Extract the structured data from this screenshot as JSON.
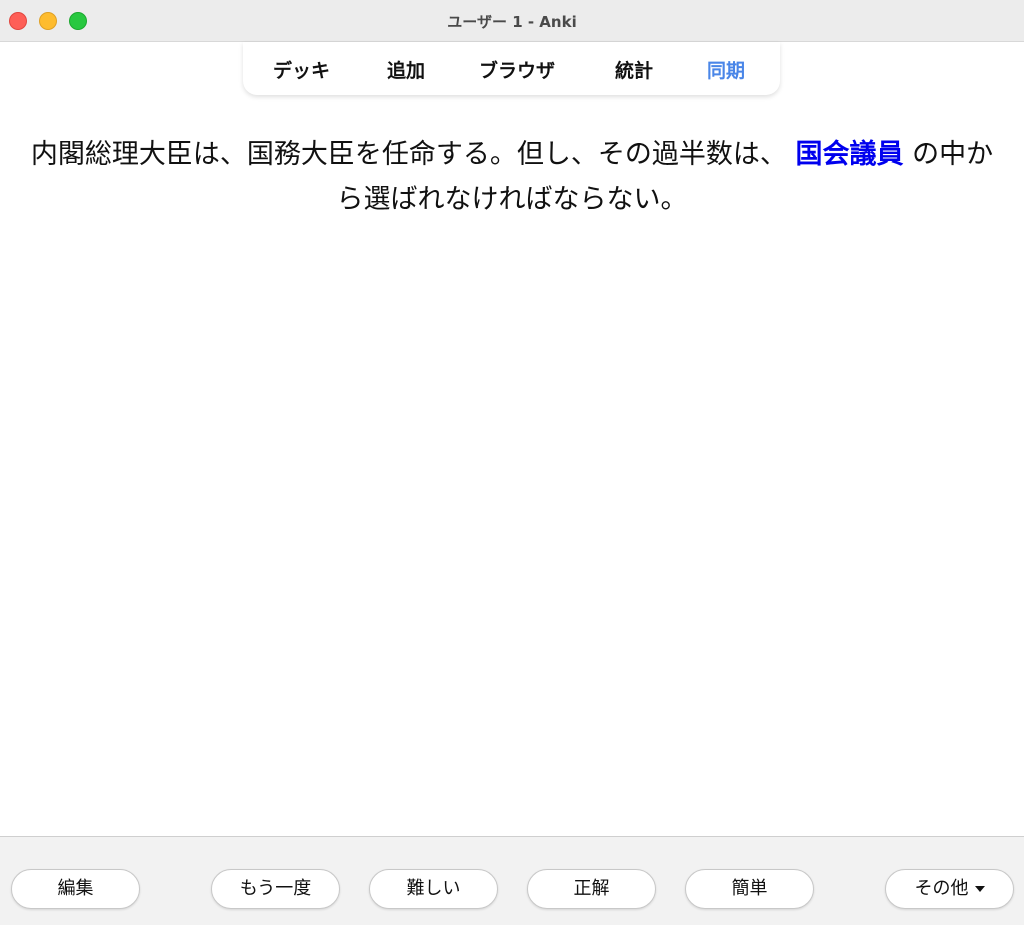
{
  "window": {
    "title": "ユーザー 1 - Anki"
  },
  "toolbar": {
    "decks": "デッキ",
    "add": "追加",
    "browse": "ブラウザ",
    "stats": "統計",
    "sync": "同期",
    "sync_color": "#4a86e8"
  },
  "card": {
    "text_before": "内閣総理大臣は、国務大臣を任命する。但し、その過半数は、",
    "cloze_answer": "国会議員",
    "text_after": "の中から選ばれなければならない。",
    "cloze_color": "#0000ee"
  },
  "bottom": {
    "edit": "編集",
    "again": "もう一度",
    "hard": "難しい",
    "good": "正解",
    "easy": "簡単",
    "more": "その他"
  }
}
